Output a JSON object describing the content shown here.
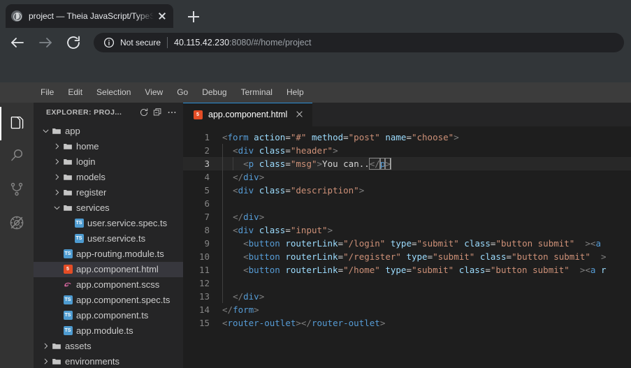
{
  "browser": {
    "tab": {
      "title": "project — Theia JavaScript/TypeS",
      "favicon": "theia-favicon",
      "close": "×"
    },
    "new_tab_label": "+",
    "nav": {
      "back": "back-arrow",
      "forward": "forward-arrow",
      "reload": "reload"
    },
    "omnibox": {
      "security_icon": "info-circle-icon",
      "security_label": "Not secure",
      "url_host": "40.115.42.230",
      "url_rest": ":8080/#/home/project"
    }
  },
  "ide": {
    "menubar": [
      "File",
      "Edit",
      "Selection",
      "View",
      "Go",
      "Debug",
      "Terminal",
      "Help"
    ],
    "activitybar": [
      {
        "name": "explorer",
        "icon": "files-icon",
        "active": true
      },
      {
        "name": "search",
        "icon": "search-icon",
        "active": false
      },
      {
        "name": "source-control",
        "icon": "git-branch-icon",
        "active": false
      },
      {
        "name": "debug",
        "icon": "debug-icon",
        "active": false
      }
    ],
    "sidebar": {
      "title": "EXPLORER: PROJ...",
      "actions": [
        "refresh-icon",
        "collapse-all-icon",
        "more-icon"
      ],
      "tree": [
        {
          "label": "app",
          "depth": 0,
          "type": "folder",
          "expanded": true,
          "selected": false
        },
        {
          "label": "home",
          "depth": 1,
          "type": "folder",
          "expanded": false,
          "selected": false
        },
        {
          "label": "login",
          "depth": 1,
          "type": "folder",
          "expanded": false,
          "selected": false
        },
        {
          "label": "models",
          "depth": 1,
          "type": "folder",
          "expanded": false,
          "selected": false
        },
        {
          "label": "register",
          "depth": 1,
          "type": "folder",
          "expanded": false,
          "selected": false
        },
        {
          "label": "services",
          "depth": 1,
          "type": "folder",
          "expanded": true,
          "selected": false
        },
        {
          "label": "user.service.spec.ts",
          "depth": 2,
          "type": "ts",
          "selected": false
        },
        {
          "label": "user.service.ts",
          "depth": 2,
          "type": "ts",
          "selected": false
        },
        {
          "label": "app-routing.module.ts",
          "depth": 1,
          "type": "ts",
          "selected": false
        },
        {
          "label": "app.component.html",
          "depth": 1,
          "type": "html",
          "selected": true
        },
        {
          "label": "app.component.scss",
          "depth": 1,
          "type": "scss",
          "selected": false
        },
        {
          "label": "app.component.spec.ts",
          "depth": 1,
          "type": "ts",
          "selected": false
        },
        {
          "label": "app.component.ts",
          "depth": 1,
          "type": "ts",
          "selected": false
        },
        {
          "label": "app.module.ts",
          "depth": 1,
          "type": "ts",
          "selected": false
        },
        {
          "label": "assets",
          "depth": 0,
          "type": "folder",
          "expanded": false,
          "selected": false
        },
        {
          "label": "environments",
          "depth": 0,
          "type": "folder",
          "expanded": false,
          "selected": false
        }
      ]
    },
    "editor": {
      "tab": {
        "label": "app.component.html",
        "icon": "html5-icon",
        "close": "×"
      },
      "cursor_line": 3,
      "lines": [
        {
          "n": "1",
          "indent": 0,
          "guides": 0,
          "tokens": [
            [
              "t-angle",
              "<"
            ],
            [
              "t-tag",
              "form"
            ],
            [
              "t-txt",
              " "
            ],
            [
              "t-attr",
              "action"
            ],
            [
              "t-eq",
              "="
            ],
            [
              "t-str",
              "\"#\""
            ],
            [
              "t-txt",
              " "
            ],
            [
              "t-attr",
              "method"
            ],
            [
              "t-eq",
              "="
            ],
            [
              "t-str",
              "\"post\""
            ],
            [
              "t-txt",
              " "
            ],
            [
              "t-attr",
              "name"
            ],
            [
              "t-eq",
              "="
            ],
            [
              "t-str",
              "\"choose\""
            ],
            [
              "t-angle",
              ">"
            ]
          ]
        },
        {
          "n": "2",
          "indent": 1,
          "guides": 1,
          "tokens": [
            [
              "t-angle",
              "<"
            ],
            [
              "t-tag",
              "div"
            ],
            [
              "t-txt",
              " "
            ],
            [
              "t-attr",
              "class"
            ],
            [
              "t-eq",
              "="
            ],
            [
              "t-str",
              "\"header\""
            ],
            [
              "t-angle",
              ">"
            ]
          ]
        },
        {
          "n": "3",
          "indent": 2,
          "guides": 2,
          "current": true,
          "tokens": [
            [
              "t-angle",
              "<"
            ],
            [
              "t-tag",
              "p"
            ],
            [
              "t-txt",
              " "
            ],
            [
              "t-attr",
              "class"
            ],
            [
              "t-eq",
              "="
            ],
            [
              "t-str",
              "\"msg\""
            ],
            [
              "t-angle",
              ">"
            ],
            [
              "t-txt",
              "You can.."
            ],
            [
              "bmatch-open",
              "</"
            ],
            [
              "bmatch-tag",
              "p"
            ],
            [
              "bmatch-close",
              ">"
            ],
            [
              "caret",
              ""
            ]
          ]
        },
        {
          "n": "4",
          "indent": 1,
          "guides": 1,
          "tokens": [
            [
              "t-angle",
              "</"
            ],
            [
              "t-tag",
              "div"
            ],
            [
              "t-angle",
              ">"
            ]
          ]
        },
        {
          "n": "5",
          "indent": 1,
          "guides": 1,
          "tokens": [
            [
              "t-angle",
              "<"
            ],
            [
              "t-tag",
              "div"
            ],
            [
              "t-txt",
              " "
            ],
            [
              "t-attr",
              "class"
            ],
            [
              "t-eq",
              "="
            ],
            [
              "t-str",
              "\"description\""
            ],
            [
              "t-angle",
              ">"
            ]
          ]
        },
        {
          "n": "6",
          "indent": 0,
          "guides": 1,
          "tokens": []
        },
        {
          "n": "7",
          "indent": 1,
          "guides": 1,
          "tokens": [
            [
              "t-angle",
              "</"
            ],
            [
              "t-tag",
              "div"
            ],
            [
              "t-angle",
              ">"
            ]
          ]
        },
        {
          "n": "8",
          "indent": 1,
          "guides": 1,
          "tokens": [
            [
              "t-angle",
              "<"
            ],
            [
              "t-tag",
              "div"
            ],
            [
              "t-txt",
              " "
            ],
            [
              "t-attr",
              "class"
            ],
            [
              "t-eq",
              "="
            ],
            [
              "t-str",
              "\"input\""
            ],
            [
              "t-angle",
              ">"
            ]
          ]
        },
        {
          "n": "9",
          "indent": 2,
          "guides": 1,
          "tokens": [
            [
              "t-angle",
              "<"
            ],
            [
              "t-tag",
              "button"
            ],
            [
              "t-txt",
              " "
            ],
            [
              "t-attr",
              "routerLink"
            ],
            [
              "t-eq",
              "="
            ],
            [
              "t-str",
              "\"/login\""
            ],
            [
              "t-txt",
              " "
            ],
            [
              "t-attr",
              "type"
            ],
            [
              "t-eq",
              "="
            ],
            [
              "t-str",
              "\"submit\""
            ],
            [
              "t-txt",
              " "
            ],
            [
              "t-attr",
              "class"
            ],
            [
              "t-eq",
              "="
            ],
            [
              "t-str",
              "\"button submit\""
            ],
            [
              "t-txt",
              "  "
            ],
            [
              "t-angle",
              ">"
            ],
            [
              "t-angle",
              "<"
            ],
            [
              "t-tag",
              "a"
            ]
          ]
        },
        {
          "n": "10",
          "indent": 2,
          "guides": 1,
          "tokens": [
            [
              "t-angle",
              "<"
            ],
            [
              "t-tag",
              "button"
            ],
            [
              "t-txt",
              " "
            ],
            [
              "t-attr",
              "routerLink"
            ],
            [
              "t-eq",
              "="
            ],
            [
              "t-str",
              "\"/register\""
            ],
            [
              "t-txt",
              " "
            ],
            [
              "t-attr",
              "type"
            ],
            [
              "t-eq",
              "="
            ],
            [
              "t-str",
              "\"submit\""
            ],
            [
              "t-txt",
              " "
            ],
            [
              "t-attr",
              "class"
            ],
            [
              "t-eq",
              "="
            ],
            [
              "t-str",
              "\"button submit\""
            ],
            [
              "t-txt",
              "  "
            ],
            [
              "t-angle",
              ">"
            ]
          ]
        },
        {
          "n": "11",
          "indent": 2,
          "guides": 1,
          "tokens": [
            [
              "t-angle",
              "<"
            ],
            [
              "t-tag",
              "button"
            ],
            [
              "t-txt",
              " "
            ],
            [
              "t-attr",
              "routerLink"
            ],
            [
              "t-eq",
              "="
            ],
            [
              "t-str",
              "\"/home\""
            ],
            [
              "t-txt",
              " "
            ],
            [
              "t-attr",
              "type"
            ],
            [
              "t-eq",
              "="
            ],
            [
              "t-str",
              "\"submit\""
            ],
            [
              "t-txt",
              " "
            ],
            [
              "t-attr",
              "class"
            ],
            [
              "t-eq",
              "="
            ],
            [
              "t-str",
              "\"button submit\""
            ],
            [
              "t-txt",
              "  "
            ],
            [
              "t-angle",
              ">"
            ],
            [
              "t-angle",
              "<"
            ],
            [
              "t-tag",
              "a"
            ],
            [
              "t-txt",
              " "
            ],
            [
              "t-attr",
              "r"
            ]
          ]
        },
        {
          "n": "12",
          "indent": 0,
          "guides": 1,
          "tokens": []
        },
        {
          "n": "13",
          "indent": 1,
          "guides": 1,
          "tokens": [
            [
              "t-angle",
              "</"
            ],
            [
              "t-tag",
              "div"
            ],
            [
              "t-angle",
              ">"
            ]
          ]
        },
        {
          "n": "14",
          "indent": 0,
          "guides": 0,
          "tokens": [
            [
              "t-angle",
              "</"
            ],
            [
              "t-tag",
              "form"
            ],
            [
              "t-angle",
              ">"
            ]
          ]
        },
        {
          "n": "15",
          "indent": 0,
          "guides": 0,
          "tokens": [
            [
              "t-angle",
              "<"
            ],
            [
              "t-tag",
              "router-outlet"
            ],
            [
              "t-angle",
              ">"
            ],
            [
              "t-angle",
              "</"
            ],
            [
              "t-tag",
              "router-outlet"
            ],
            [
              "t-angle",
              ">"
            ]
          ]
        }
      ]
    }
  }
}
